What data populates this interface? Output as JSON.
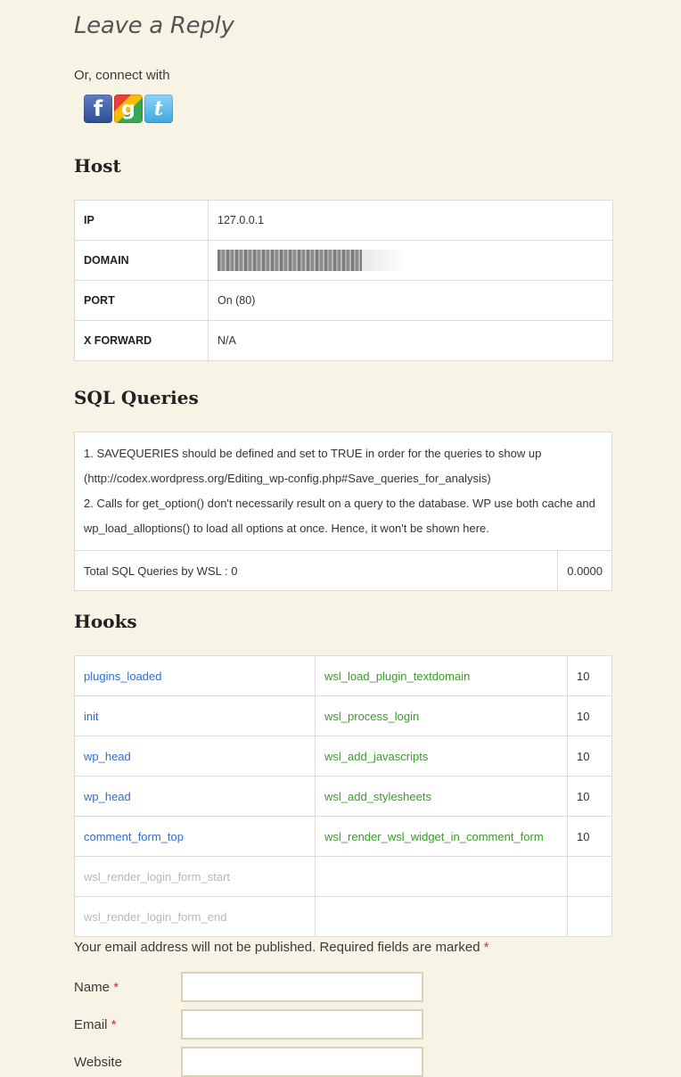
{
  "reply": {
    "title": "Leave a Reply",
    "connect_text": "Or, connect with",
    "social": [
      {
        "name": "facebook",
        "icon": "facebook-icon",
        "glyph": "f"
      },
      {
        "name": "google",
        "icon": "google-icon",
        "glyph": "g"
      },
      {
        "name": "twitter",
        "icon": "twitter-icon",
        "glyph": "t"
      }
    ]
  },
  "host": {
    "heading": "Host",
    "rows": [
      {
        "key": "IP",
        "value": "127.0.0.1"
      },
      {
        "key": "DOMAIN",
        "value": ""
      },
      {
        "key": "PORT",
        "value": "On (80)"
      },
      {
        "key": "X FORWARD",
        "value": "N/A"
      }
    ]
  },
  "sql": {
    "heading": "SQL Queries",
    "note_1": "1. SAVEQUERIES should be defined and set to TRUE in order for the queries to show up",
    "note_1b": "(http://codex.wordpress.org/Editing_wp-config.php#Save_queries_for_analysis)",
    "note_2": "2. Calls for get_option() don't necessarily result on a query to the database. WP use both cache and",
    "note_2b": "wp_load_alloptions() to load all options at once. Hence, it won't be shown here.",
    "total_label": "Total SQL Queries by WSL : 0",
    "total_time": "0.0000"
  },
  "hooks": {
    "heading": "Hooks",
    "rows": [
      {
        "hook": "plugins_loaded",
        "func": "wsl_load_plugin_textdomain",
        "priority": "10",
        "active": true
      },
      {
        "hook": "init",
        "func": "wsl_process_login",
        "priority": "10",
        "active": true
      },
      {
        "hook": "wp_head",
        "func": "wsl_add_javascripts",
        "priority": "10",
        "active": true
      },
      {
        "hook": "wp_head",
        "func": "wsl_add_stylesheets",
        "priority": "10",
        "active": true
      },
      {
        "hook": "comment_form_top",
        "func": "wsl_render_wsl_widget_in_comment_form",
        "priority": "10",
        "active": true
      },
      {
        "hook": "wsl_render_login_form_start",
        "func": "",
        "priority": "",
        "active": false
      },
      {
        "hook": "wsl_render_login_form_end",
        "func": "",
        "priority": "",
        "active": false
      }
    ]
  },
  "form": {
    "email_note": "Your email address will not be published. Required fields are marked",
    "required_mark": "*",
    "fields": [
      {
        "label": "Name",
        "required": true,
        "value": ""
      },
      {
        "label": "Email",
        "required": true,
        "value": ""
      },
      {
        "label": "Website",
        "required": false,
        "value": ""
      }
    ]
  },
  "colors": {
    "background": "#f7f4e6",
    "hook_link": "#2e6dd6",
    "function_link": "#3a9a2a",
    "inactive": "#b7b7b7",
    "required": "#c4352a"
  }
}
